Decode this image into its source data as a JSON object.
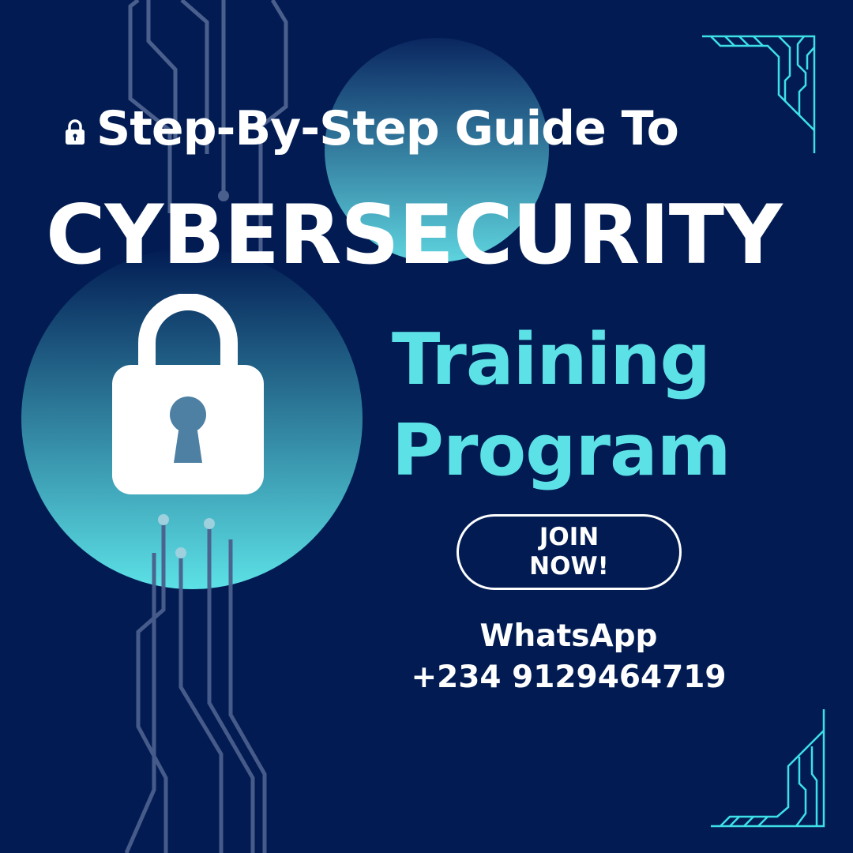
{
  "poster": {
    "subtitle": "Step-By-Step Guide To",
    "title": "CYBERSECURITY",
    "highlight_line1": "Training",
    "highlight_line2": "Program",
    "cta_line1": "JOIN",
    "cta_line2": "NOW!",
    "contact_label": "WhatsApp",
    "contact_phone": "+234 9129464719"
  },
  "icons": {
    "small": "lock-icon",
    "large": "padlock-icon"
  },
  "colors": {
    "background": "#021c53",
    "accent": "#5ce1e6",
    "text": "#ffffff",
    "circuit": "#4a5f8c"
  }
}
